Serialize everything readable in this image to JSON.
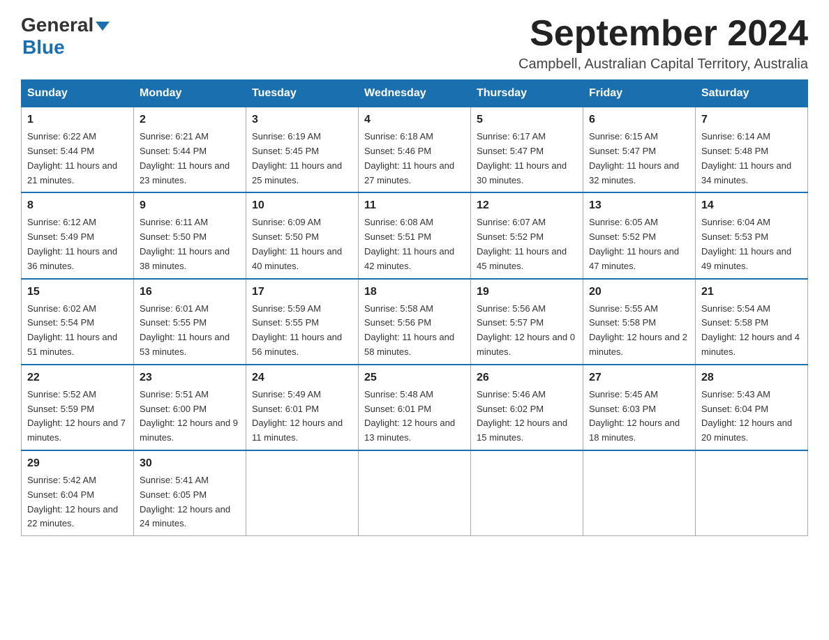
{
  "header": {
    "logo_line1": "General",
    "logo_line2": "Blue",
    "month_year": "September 2024",
    "location": "Campbell, Australian Capital Territory, Australia"
  },
  "days_of_week": [
    "Sunday",
    "Monday",
    "Tuesday",
    "Wednesday",
    "Thursday",
    "Friday",
    "Saturday"
  ],
  "weeks": [
    [
      {
        "day": "1",
        "sunrise": "6:22 AM",
        "sunset": "5:44 PM",
        "daylight": "11 hours and 21 minutes."
      },
      {
        "day": "2",
        "sunrise": "6:21 AM",
        "sunset": "5:44 PM",
        "daylight": "11 hours and 23 minutes."
      },
      {
        "day": "3",
        "sunrise": "6:19 AM",
        "sunset": "5:45 PM",
        "daylight": "11 hours and 25 minutes."
      },
      {
        "day": "4",
        "sunrise": "6:18 AM",
        "sunset": "5:46 PM",
        "daylight": "11 hours and 27 minutes."
      },
      {
        "day": "5",
        "sunrise": "6:17 AM",
        "sunset": "5:47 PM",
        "daylight": "11 hours and 30 minutes."
      },
      {
        "day": "6",
        "sunrise": "6:15 AM",
        "sunset": "5:47 PM",
        "daylight": "11 hours and 32 minutes."
      },
      {
        "day": "7",
        "sunrise": "6:14 AM",
        "sunset": "5:48 PM",
        "daylight": "11 hours and 34 minutes."
      }
    ],
    [
      {
        "day": "8",
        "sunrise": "6:12 AM",
        "sunset": "5:49 PM",
        "daylight": "11 hours and 36 minutes."
      },
      {
        "day": "9",
        "sunrise": "6:11 AM",
        "sunset": "5:50 PM",
        "daylight": "11 hours and 38 minutes."
      },
      {
        "day": "10",
        "sunrise": "6:09 AM",
        "sunset": "5:50 PM",
        "daylight": "11 hours and 40 minutes."
      },
      {
        "day": "11",
        "sunrise": "6:08 AM",
        "sunset": "5:51 PM",
        "daylight": "11 hours and 42 minutes."
      },
      {
        "day": "12",
        "sunrise": "6:07 AM",
        "sunset": "5:52 PM",
        "daylight": "11 hours and 45 minutes."
      },
      {
        "day": "13",
        "sunrise": "6:05 AM",
        "sunset": "5:52 PM",
        "daylight": "11 hours and 47 minutes."
      },
      {
        "day": "14",
        "sunrise": "6:04 AM",
        "sunset": "5:53 PM",
        "daylight": "11 hours and 49 minutes."
      }
    ],
    [
      {
        "day": "15",
        "sunrise": "6:02 AM",
        "sunset": "5:54 PM",
        "daylight": "11 hours and 51 minutes."
      },
      {
        "day": "16",
        "sunrise": "6:01 AM",
        "sunset": "5:55 PM",
        "daylight": "11 hours and 53 minutes."
      },
      {
        "day": "17",
        "sunrise": "5:59 AM",
        "sunset": "5:55 PM",
        "daylight": "11 hours and 56 minutes."
      },
      {
        "day": "18",
        "sunrise": "5:58 AM",
        "sunset": "5:56 PM",
        "daylight": "11 hours and 58 minutes."
      },
      {
        "day": "19",
        "sunrise": "5:56 AM",
        "sunset": "5:57 PM",
        "daylight": "12 hours and 0 minutes."
      },
      {
        "day": "20",
        "sunrise": "5:55 AM",
        "sunset": "5:58 PM",
        "daylight": "12 hours and 2 minutes."
      },
      {
        "day": "21",
        "sunrise": "5:54 AM",
        "sunset": "5:58 PM",
        "daylight": "12 hours and 4 minutes."
      }
    ],
    [
      {
        "day": "22",
        "sunrise": "5:52 AM",
        "sunset": "5:59 PM",
        "daylight": "12 hours and 7 minutes."
      },
      {
        "day": "23",
        "sunrise": "5:51 AM",
        "sunset": "6:00 PM",
        "daylight": "12 hours and 9 minutes."
      },
      {
        "day": "24",
        "sunrise": "5:49 AM",
        "sunset": "6:01 PM",
        "daylight": "12 hours and 11 minutes."
      },
      {
        "day": "25",
        "sunrise": "5:48 AM",
        "sunset": "6:01 PM",
        "daylight": "12 hours and 13 minutes."
      },
      {
        "day": "26",
        "sunrise": "5:46 AM",
        "sunset": "6:02 PM",
        "daylight": "12 hours and 15 minutes."
      },
      {
        "day": "27",
        "sunrise": "5:45 AM",
        "sunset": "6:03 PM",
        "daylight": "12 hours and 18 minutes."
      },
      {
        "day": "28",
        "sunrise": "5:43 AM",
        "sunset": "6:04 PM",
        "daylight": "12 hours and 20 minutes."
      }
    ],
    [
      {
        "day": "29",
        "sunrise": "5:42 AM",
        "sunset": "6:04 PM",
        "daylight": "12 hours and 22 minutes."
      },
      {
        "day": "30",
        "sunrise": "5:41 AM",
        "sunset": "6:05 PM",
        "daylight": "12 hours and 24 minutes."
      },
      null,
      null,
      null,
      null,
      null
    ]
  ],
  "labels": {
    "sunrise_prefix": "Sunrise: ",
    "sunset_prefix": "Sunset: ",
    "daylight_prefix": "Daylight: "
  }
}
